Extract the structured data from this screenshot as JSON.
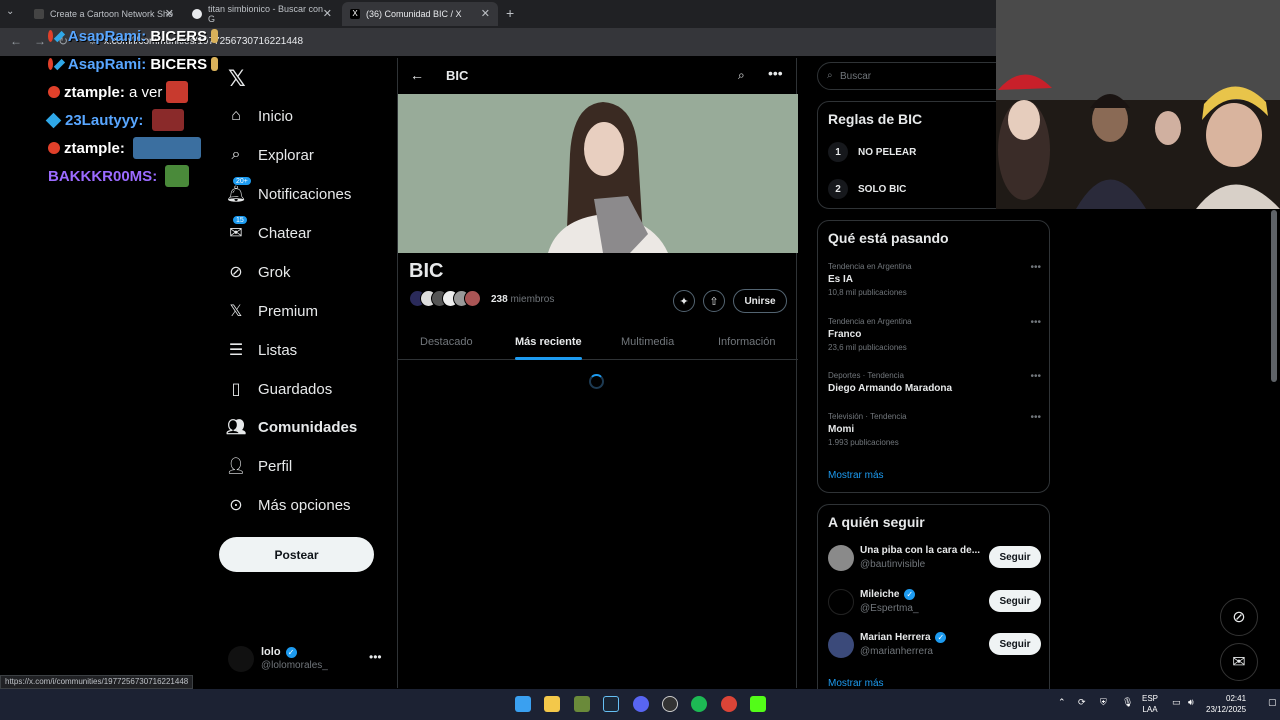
{
  "browser": {
    "tabs": [
      {
        "title": "Create a Cartoon Network Sho"
      },
      {
        "title": "titan simbionico - Buscar con G"
      },
      {
        "title": "(36) Comunidad BIC / X"
      }
    ],
    "url": "x.com/i/communities/1977256730716221448",
    "status_link": "https://x.com/i/communities/1977256730716221448"
  },
  "chat": {
    "lines": [
      {
        "user": "AsapRami",
        "msg": "BICERS"
      },
      {
        "user": "AsapRami",
        "msg": "BICERS"
      },
      {
        "user": "ztample",
        "msg": "a ver"
      },
      {
        "user": "23Lautyyy",
        "msg": ""
      },
      {
        "user": "ztample",
        "msg": ""
      },
      {
        "user": "BAKKKR00MS",
        "msg": ""
      }
    ]
  },
  "nav": {
    "items": [
      {
        "label": "Inicio"
      },
      {
        "label": "Explorar"
      },
      {
        "label": "Notificaciones",
        "badge": "20+"
      },
      {
        "label": "Chatear",
        "badge": "15"
      },
      {
        "label": "Grok"
      },
      {
        "label": "Premium"
      },
      {
        "label": "Listas"
      },
      {
        "label": "Guardados"
      },
      {
        "label": "Comunidades"
      },
      {
        "label": "Perfil"
      },
      {
        "label": "Más opciones"
      }
    ],
    "post_label": "Postear",
    "profile": {
      "name": "lolo",
      "handle": "@lolomorales_"
    }
  },
  "main": {
    "header_title": "BIC",
    "community_name": "BIC",
    "member_count": "238",
    "member_label": "miembros",
    "join_label": "Unirse",
    "tabs": [
      {
        "label": "Destacado"
      },
      {
        "label": "Más reciente"
      },
      {
        "label": "Multimedia"
      },
      {
        "label": "Información"
      }
    ]
  },
  "right": {
    "search_placeholder": "Buscar",
    "rules_title": "Reglas de BIC",
    "rules": [
      {
        "num": "1",
        "text": "NO PELEAR"
      },
      {
        "num": "2",
        "text": "SOLO BIC"
      }
    ],
    "trends_title": "Qué está pasando",
    "trends": [
      {
        "context": "Tendencia en Argentina",
        "name": "Es IA",
        "count": "10,8 mil publicaciones"
      },
      {
        "context": "Tendencia en Argentina",
        "name": "Franco",
        "count": "23,6 mil publicaciones"
      },
      {
        "context": "Deportes · Tendencia",
        "name": "Diego Armando Maradona",
        "count": ""
      },
      {
        "context": "Televisión · Tendencia",
        "name": "Momi",
        "count": "1.993 publicaciones"
      }
    ],
    "show_more": "Mostrar más",
    "follow_title": "A quién seguir",
    "follow": [
      {
        "name": "Una piba con la cara de...",
        "handle": "@bautinvisible",
        "verified": false
      },
      {
        "name": "Mileiche",
        "handle": "@Espertma_",
        "verified": true
      },
      {
        "name": "Marian Herrera",
        "handle": "@marianherrera",
        "verified": true
      }
    ],
    "follow_label": "Seguir",
    "follow_show_more": "Mostrar más"
  },
  "taskbar": {
    "lang_top": "ESP",
    "lang_bottom": "LAA",
    "time": "02:41",
    "date": "23/12/2025"
  },
  "colors": {
    "accent": "#1d9bf0",
    "background": "#000000",
    "border": "#2f3336"
  }
}
